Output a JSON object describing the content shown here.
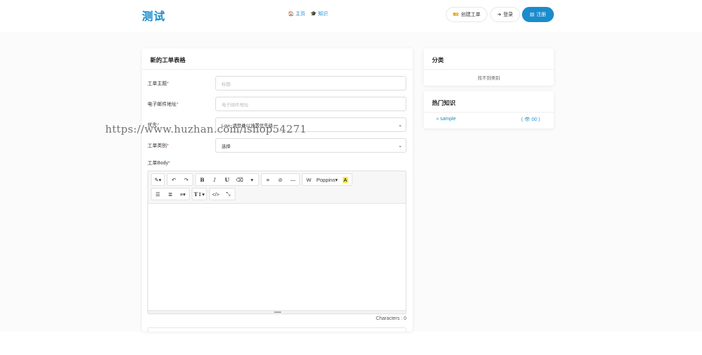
{
  "header": {
    "brand": "测试",
    "nav": [
      {
        "icon": "home-icon",
        "glyph": "🏠",
        "label": "主页"
      },
      {
        "icon": "graduation-cap-icon",
        "glyph": "🎓",
        "label": "知识"
      }
    ],
    "create_ticket": {
      "icon": "ticket-icon",
      "glyph": "🎫",
      "label": "创建工单"
    },
    "login": {
      "icon": "sign-in-icon",
      "glyph": "➔",
      "label": "登录"
    },
    "register": {
      "icon": "register-icon",
      "glyph": "▤",
      "label": "注册"
    }
  },
  "form": {
    "title": "新的工单表格",
    "fields": {
      "subject": {
        "label": "工单主题",
        "required": "*",
        "placeholder": "标题"
      },
      "email": {
        "label": "电子邮件地址",
        "required": "*",
        "placeholder": "电子邮件地址"
      },
      "priority": {
        "label": "优先",
        "required": "*",
        "value": "Low~请登录以设置优先级"
      },
      "category": {
        "label": "工单类别",
        "required": "*",
        "value": "选择"
      },
      "body": {
        "label": "工单Body",
        "required": "*"
      }
    },
    "editor": {
      "toolbar_row1": [
        "✎▾",
        "↶",
        "↷",
        "B",
        "I",
        "U",
        "⌫",
        "▾",
        "≡",
        "⊘",
        "—",
        "W",
        "Poppins▾",
        "A"
      ],
      "toolbar_row2": [
        "☰",
        "≣",
        "≡▾",
        "T↕▾",
        "</>",
        "⤡"
      ],
      "char_count": "Characters : 0"
    },
    "watermark": "https://www.huzhan.com/ishop54271"
  },
  "sidebar": {
    "category": {
      "title": "分类",
      "empty": "找不到类别"
    },
    "hot_knowledge": {
      "title": "热门知识",
      "items": [
        {
          "prefix": "»",
          "label": "sample",
          "views": "( 👁 00 )"
        }
      ]
    }
  },
  "colors": {
    "accent": "#1a8ccc",
    "required": "#d9534f",
    "highlight": "#ffef3a"
  }
}
